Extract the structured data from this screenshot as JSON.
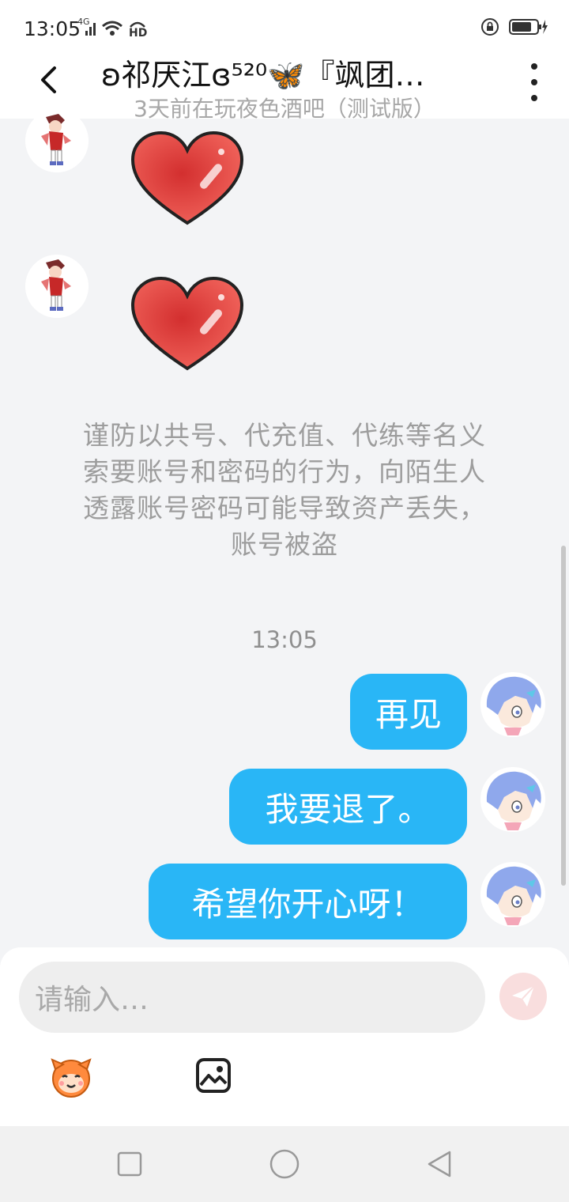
{
  "status_bar": {
    "time": "13:05",
    "network_label": "4G",
    "hd_label": "HD",
    "icons": [
      "signal-icon",
      "wifi-icon",
      "hd-icon",
      "lock-rotation-icon",
      "battery-icon"
    ]
  },
  "header": {
    "title": "ʚ祁厌江ɞ⁵²⁰🦋『飒团…",
    "subtitle": "3天前在玩夜色酒吧（测试版）",
    "back_icon": "chevron-left-icon",
    "more_icon": "more-vertical-icon"
  },
  "chat": {
    "incoming": [
      {
        "type": "sticker",
        "sticker": "red-heart"
      },
      {
        "type": "sticker",
        "sticker": "red-heart"
      }
    ],
    "warning_lines": [
      "谨防以共号、代充值、代练等名义",
      "索要账号和密码的行为，向陌生人",
      "透露账号密码可能导致资产丢失，",
      "账号被盗"
    ],
    "timestamp": "13:05",
    "outgoing": [
      {
        "text": "再见"
      },
      {
        "text": "我要退了。"
      },
      {
        "text": "希望你开心呀！"
      }
    ],
    "bubble_color": "#29b6f6"
  },
  "input": {
    "placeholder": "请输入…",
    "send_icon": "send-plane-icon",
    "emoji_icon": "emoji-face-icon",
    "image_icon": "image-icon"
  },
  "nav": {
    "icons": [
      "recent-apps-icon",
      "home-icon",
      "back-triangle-icon"
    ]
  }
}
